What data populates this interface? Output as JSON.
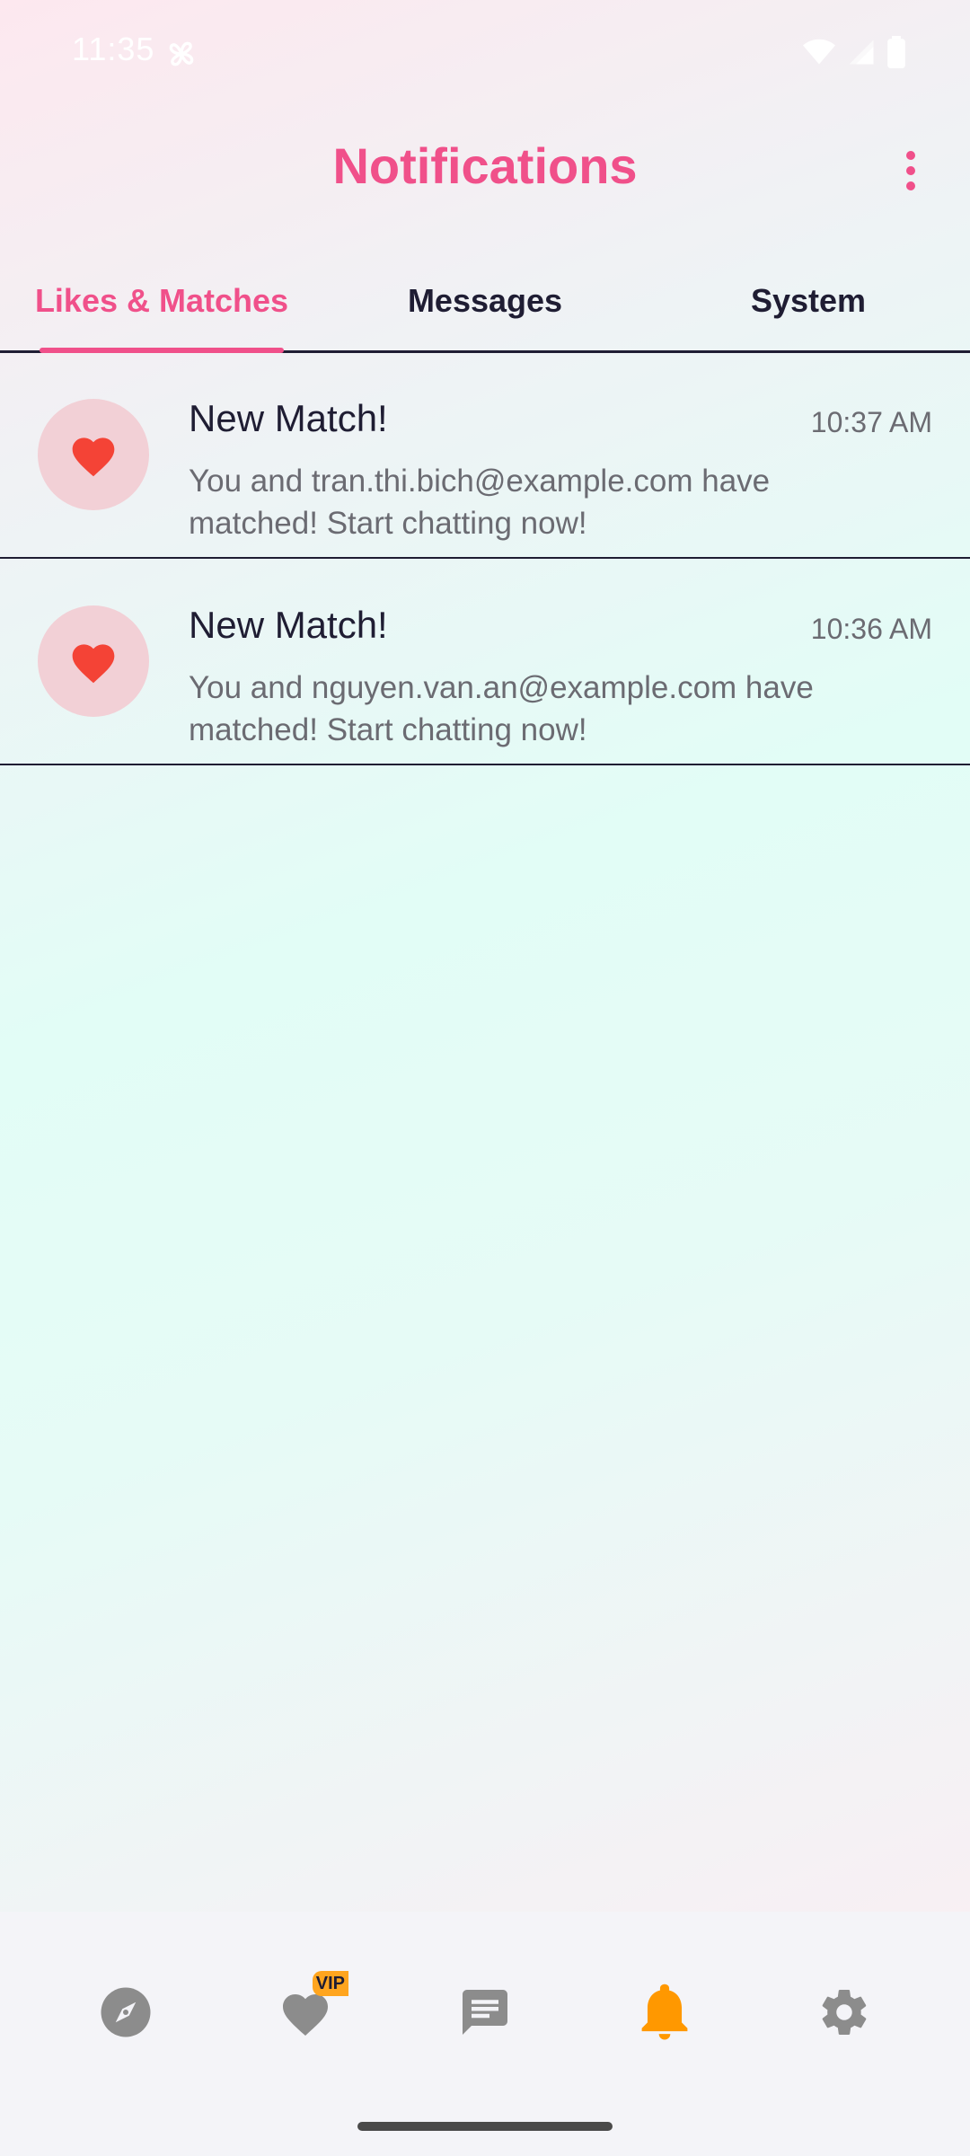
{
  "status_bar": {
    "time": "11:35"
  },
  "header": {
    "title": "Notifications"
  },
  "tabs": [
    {
      "label": "Likes & Matches",
      "active": true
    },
    {
      "label": "Messages",
      "active": false
    },
    {
      "label": "System",
      "active": false
    }
  ],
  "notifications": [
    {
      "icon": "heart-icon",
      "title": "New Match!",
      "time": "10:37 AM",
      "body": "You and tran.thi.bich@example.com have matched! Start chatting now!"
    },
    {
      "icon": "heart-icon",
      "title": "New Match!",
      "time": "10:36 AM",
      "body": "You and nguyen.van.an@example.com have matched! Start chatting now!"
    }
  ],
  "bottom_nav": {
    "items": [
      {
        "name": "compass-icon",
        "active": false
      },
      {
        "name": "heart-icon",
        "active": false,
        "badge": "VIP"
      },
      {
        "name": "chat-icon",
        "active": false
      },
      {
        "name": "bell-icon",
        "active": true
      },
      {
        "name": "gear-icon",
        "active": false
      }
    ]
  },
  "colors": {
    "accent": "#f0508a",
    "heart": "#f44336",
    "active_nav": "#ff9800",
    "inactive_nav": "#8c8c8c",
    "vip_badge": "#ffa51f"
  }
}
